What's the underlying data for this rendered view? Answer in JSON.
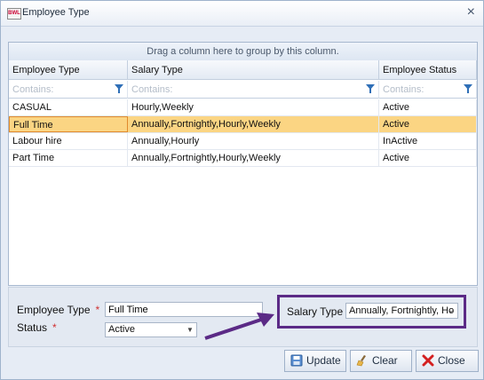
{
  "window": {
    "title": "Employee Type",
    "app_icon_text": "BWL"
  },
  "grid": {
    "group_hint": "Drag a column here to group by this column.",
    "columns": [
      "Employee Type",
      "Salary Type",
      "Employee Status"
    ],
    "filter_placeholder": "Contains:",
    "rows": [
      [
        "CASUAL",
        "Hourly,Weekly",
        "Active"
      ],
      [
        "Full Time",
        "Annually,Fortnightly,Hourly,Weekly",
        "Active"
      ],
      [
        "Labour hire",
        "Annually,Hourly",
        "InActive"
      ],
      [
        "Part Time",
        "Annually,Fortnightly,Hourly,Weekly",
        "Active"
      ]
    ],
    "selected_row_index": 1
  },
  "form": {
    "employee_type_label": "Employee Type",
    "employee_type_value": "Full Time",
    "status_label": "Status",
    "status_value": "Active",
    "salary_type_label": "Salary Type",
    "salary_type_value": "Annually, Fortnightly, Ho",
    "required_marker": "*"
  },
  "buttons": {
    "update": "Update",
    "clear": "Clear",
    "close": "Close"
  },
  "colors": {
    "selected_row": "#fbd583",
    "highlight_box": "#5b2a86",
    "arrow": "#5b2a86"
  }
}
